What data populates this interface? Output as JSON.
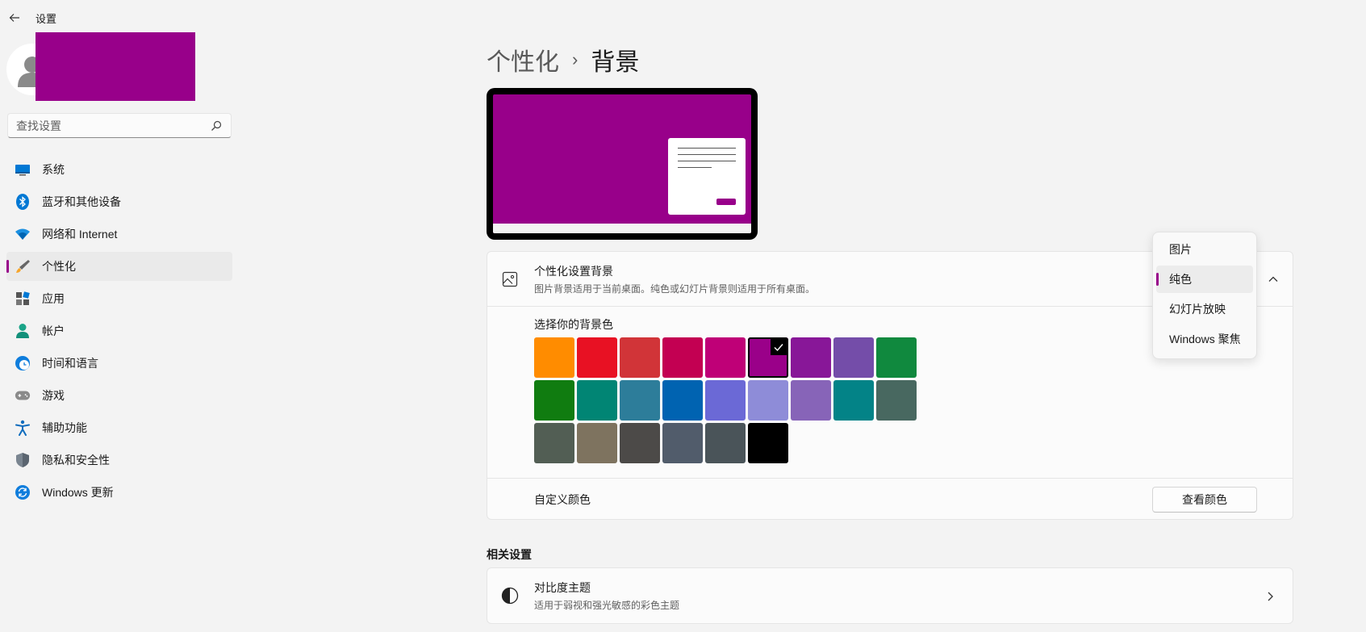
{
  "app": {
    "title": "设置"
  },
  "search": {
    "placeholder": "查找设置"
  },
  "sidebar": {
    "items": [
      {
        "label": "系统",
        "icon": "monitor-icon"
      },
      {
        "label": "蓝牙和其他设备",
        "icon": "bluetooth-icon"
      },
      {
        "label": "网络和 Internet",
        "icon": "wifi-icon"
      },
      {
        "label": "个性化",
        "icon": "brush-icon",
        "active": true
      },
      {
        "label": "应用",
        "icon": "apps-icon"
      },
      {
        "label": "帐户",
        "icon": "person-icon"
      },
      {
        "label": "时间和语言",
        "icon": "globe-clock-icon"
      },
      {
        "label": "游戏",
        "icon": "gamepad-icon"
      },
      {
        "label": "辅助功能",
        "icon": "accessibility-icon"
      },
      {
        "label": "隐私和安全性",
        "icon": "shield-icon"
      },
      {
        "label": "Windows 更新",
        "icon": "update-icon"
      }
    ]
  },
  "breadcrumb": {
    "parent": "个性化",
    "separator": "›",
    "current": "背景"
  },
  "preview": {
    "background_color": "#98008a"
  },
  "background_card": {
    "title": "个性化设置背景",
    "description": "图片背景适用于当前桌面。纯色或幻灯片背景则适用于所有桌面。",
    "color_label": "选择你的背景色",
    "colors": [
      "#ff8c00",
      "#e81123",
      "#d13438",
      "#c30052",
      "#bf0077",
      "#9a0089",
      "#881798",
      "#744da9",
      "#10893e",
      "#107c10",
      "#018574",
      "#2d7d9a",
      "#0063b1",
      "#6b69d6",
      "#8e8cd8",
      "#8764b8",
      "#038387",
      "#486860",
      "#525e54",
      "#7e735f",
      "#4c4a48",
      "#515c6b",
      "#4a5459",
      "#000000"
    ],
    "selected_index": 5,
    "custom_label": "自定义颜色",
    "view_colors_button": "查看颜色"
  },
  "dropdown": {
    "options": [
      "图片",
      "纯色",
      "幻灯片放映",
      "Windows 聚焦"
    ],
    "selected_index": 1
  },
  "related": {
    "title": "相关设置",
    "contrast_title": "对比度主题",
    "contrast_desc": "适用于弱视和强光敏感的彩色主题"
  },
  "accent_color": "#98008a"
}
